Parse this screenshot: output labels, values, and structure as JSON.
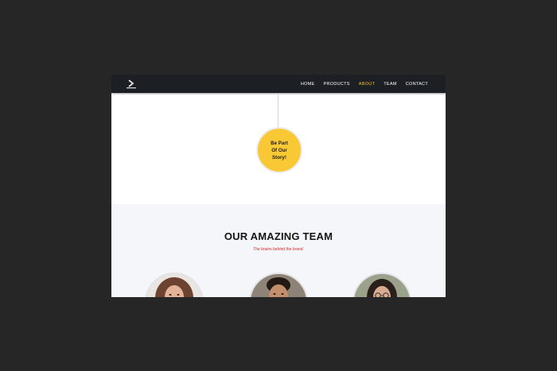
{
  "nav": {
    "logo_icon": "arrow-logo-icon",
    "items": [
      {
        "label": "HOME",
        "active": false
      },
      {
        "label": "PRODUCTS",
        "active": false
      },
      {
        "label": "ABOUT",
        "active": true
      },
      {
        "label": "TEAM",
        "active": false
      },
      {
        "label": "CONTACT",
        "active": false
      }
    ],
    "active_color": "#f5c532"
  },
  "story": {
    "label": "Be Part\nOf Our\nStory!",
    "color": "#f8c935"
  },
  "team": {
    "title": "OUR AMAZING TEAM",
    "subtitle": "The brains behind the brand.",
    "subtitle_color": "#d3282a",
    "members": [
      {
        "avatar": "woman-curly-hair-photo"
      },
      {
        "avatar": "man-smiling-photo"
      },
      {
        "avatar": "woman-glasses-photo"
      }
    ]
  }
}
